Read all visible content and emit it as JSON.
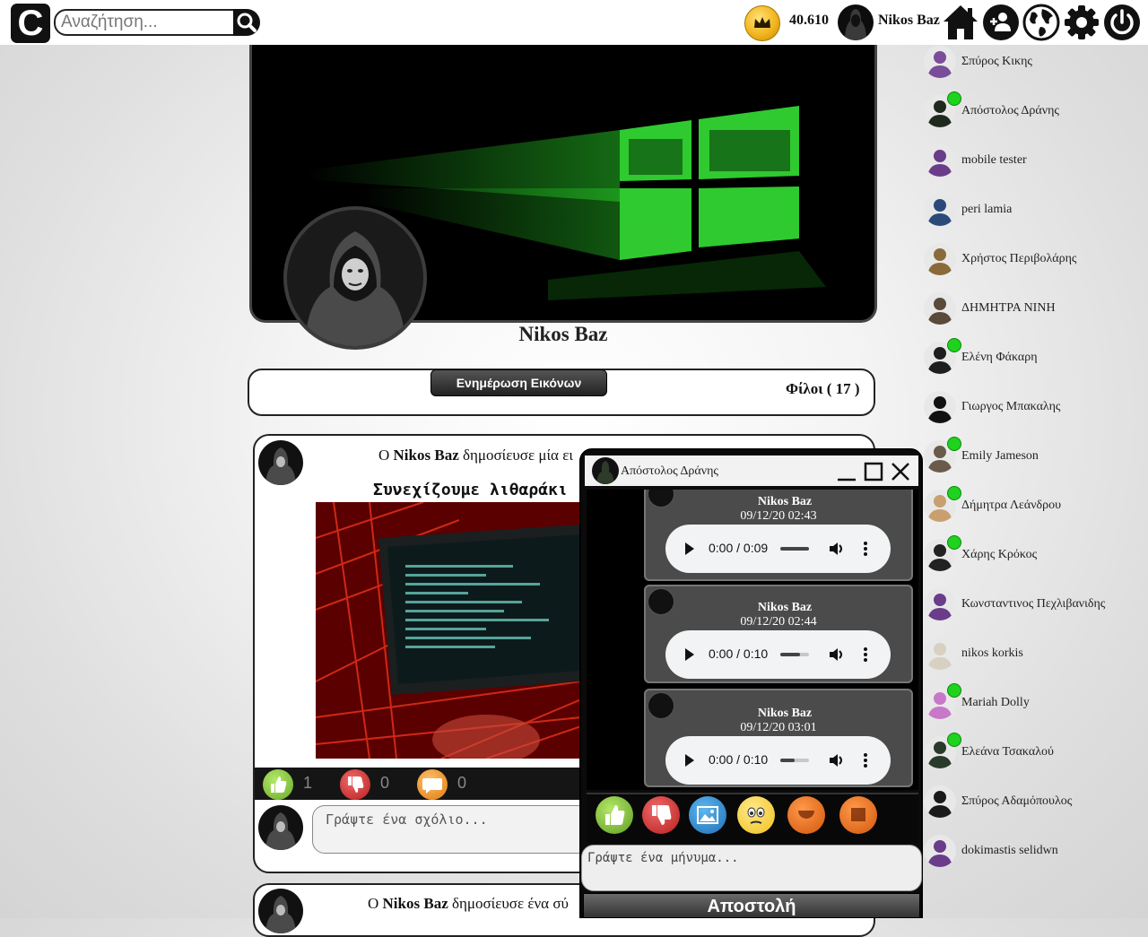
{
  "header": {
    "logo_letter": "C",
    "search_placeholder": "Αναζήτηση...",
    "coins": "40.610",
    "username": "Nikos Baz",
    "icons": [
      "home-icon",
      "add-friend-icon",
      "globe-icon",
      "gear-icon",
      "power-icon"
    ]
  },
  "profile": {
    "name": "Nikos Baz",
    "update_images_label": "Ενημέρωση Εικόνων",
    "friends_label": "Φίλοι ( 17 )"
  },
  "post": {
    "header_prefix": "Ο ",
    "header_author": "Nikos Baz",
    "header_suffix": " δημοσίευσε μία ει",
    "text": "Συνεχίζουμε λιθαράκι",
    "likes": "1",
    "dislikes": "0",
    "comments": "0",
    "comment_placeholder": "Γράψτε ένα σχόλιο..."
  },
  "post2": {
    "header_prefix": "Ο ",
    "header_author": "Nikos Baz",
    "header_suffix": " δημοσίευσε ένα σύ"
  },
  "chat": {
    "title": "Απόστολος Δράνης",
    "messages": [
      {
        "author": "Nikos Baz",
        "time": "09/12/20 02:43",
        "audio": "0:00 / 0:09"
      },
      {
        "author": "Nikos Baz",
        "time": "09/12/20 02:44",
        "audio": "0:00 / 0:10"
      },
      {
        "author": "Nikos Baz",
        "time": "09/12/20 03:01",
        "audio": "0:00 / 0:10"
      }
    ],
    "message_placeholder": "Γράψτε ένα μήνυμα...",
    "send_label": "Αποστολή"
  },
  "friends": [
    {
      "name": "Σπύρος Κικης",
      "online": false
    },
    {
      "name": "Απόστολος Δράνης",
      "online": true
    },
    {
      "name": "mobile tester",
      "online": false
    },
    {
      "name": "peri lamia",
      "online": false
    },
    {
      "name": "Χρήστος Περιβολάρης",
      "online": false
    },
    {
      "name": "ΔΗΜΗΤΡΑ ΝΙΝΗ",
      "online": false
    },
    {
      "name": "Ελένη Φάκαρη",
      "online": true
    },
    {
      "name": "Γιωργος Μπακαλης",
      "online": false
    },
    {
      "name": "Emily Jameson",
      "online": true
    },
    {
      "name": "Δήμητρα Λεάνδρου",
      "online": true
    },
    {
      "name": "Χάρης Κρόκος",
      "online": true
    },
    {
      "name": "Κωνσταντινος Πεχλιβανιδης",
      "online": false
    },
    {
      "name": "nikos korkis",
      "online": false
    },
    {
      "name": "Mariah Dolly",
      "online": true
    },
    {
      "name": "Ελεάνα Τσακαλού",
      "online": true
    },
    {
      "name": "Σπύρος Αδαμόπουλος",
      "online": false
    },
    {
      "name": "dokimastis selidwn",
      "online": false
    }
  ],
  "colors": {
    "online": "#1ed21e",
    "like": "#7cc43a",
    "dislike": "#d93636",
    "comment": "#f39a2a",
    "cover_green": "#29d629"
  }
}
